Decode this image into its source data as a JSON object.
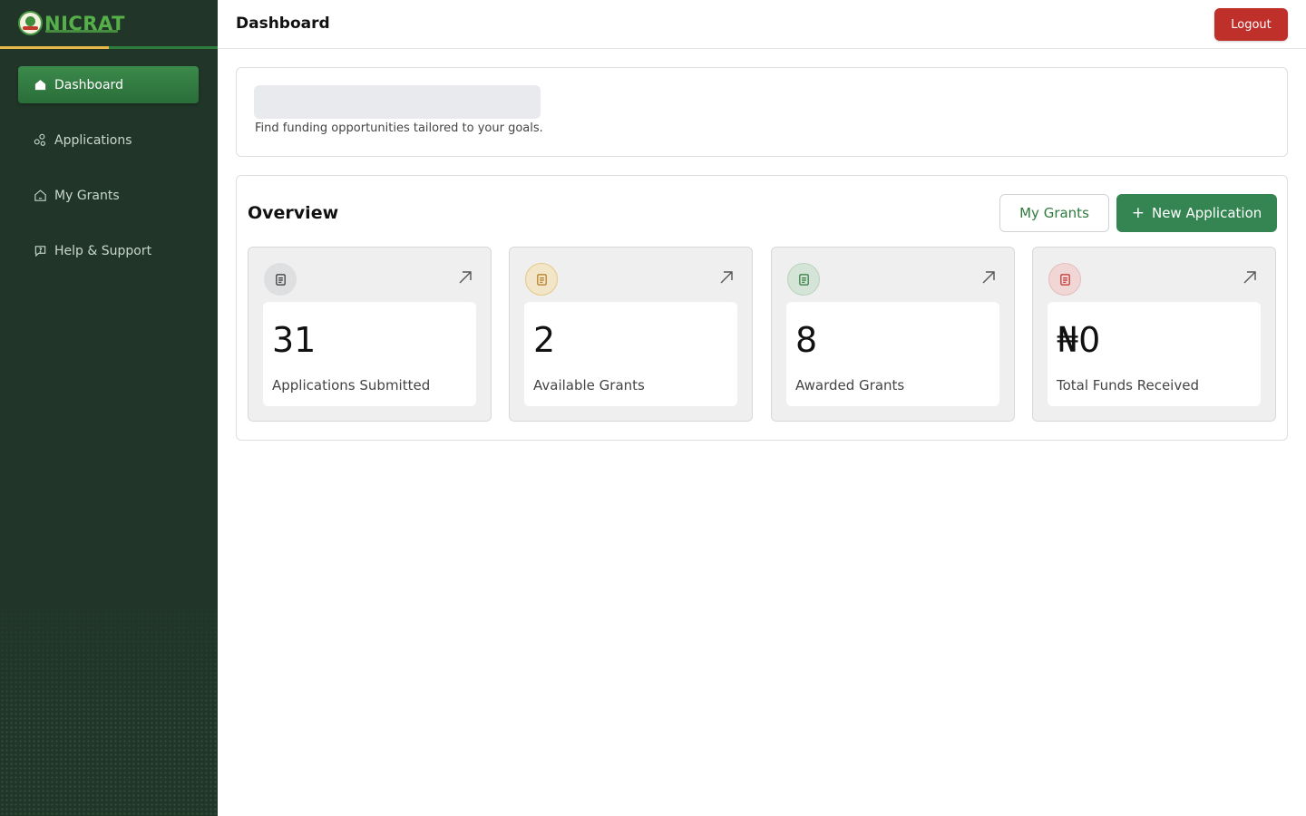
{
  "brand": {
    "name": "NICRAT"
  },
  "sidebar": {
    "items": [
      {
        "label": "Dashboard",
        "icon": "home-icon",
        "active": true
      },
      {
        "label": "Applications",
        "icon": "applications-icon",
        "active": false
      },
      {
        "label": "My Grants",
        "icon": "grants-icon",
        "active": false
      },
      {
        "label": "Help & Support",
        "icon": "help-icon",
        "active": false
      }
    ]
  },
  "header": {
    "title": "Dashboard",
    "logout_label": "Logout"
  },
  "welcome": {
    "subtitle": "Find funding opportunities tailored to your goals."
  },
  "overview": {
    "title": "Overview",
    "my_grants_label": "My Grants",
    "new_application_label": "New Application",
    "stats": [
      {
        "value": "31",
        "label": "Applications Submitted",
        "icon": "document-icon",
        "icon_color": "#333333",
        "icon_bg": "#dddfe0"
      },
      {
        "value": "2",
        "label": "Available Grants",
        "icon": "document-icon",
        "icon_color": "#b07a22",
        "icon_bg": "#f3e6c8"
      },
      {
        "value": "8",
        "label": "Awarded Grants",
        "icon": "document-icon",
        "icon_color": "#2f7a3d",
        "icon_bg": "#d4e4d6"
      },
      {
        "value": "₦0",
        "label": "Total Funds Received",
        "icon": "document-icon",
        "icon_color": "#c0302b",
        "icon_bg": "#f1d6d6"
      }
    ]
  },
  "colors": {
    "sidebar_bg": "#213629",
    "accent_green": "#348552",
    "logout_red": "#c0302b"
  }
}
